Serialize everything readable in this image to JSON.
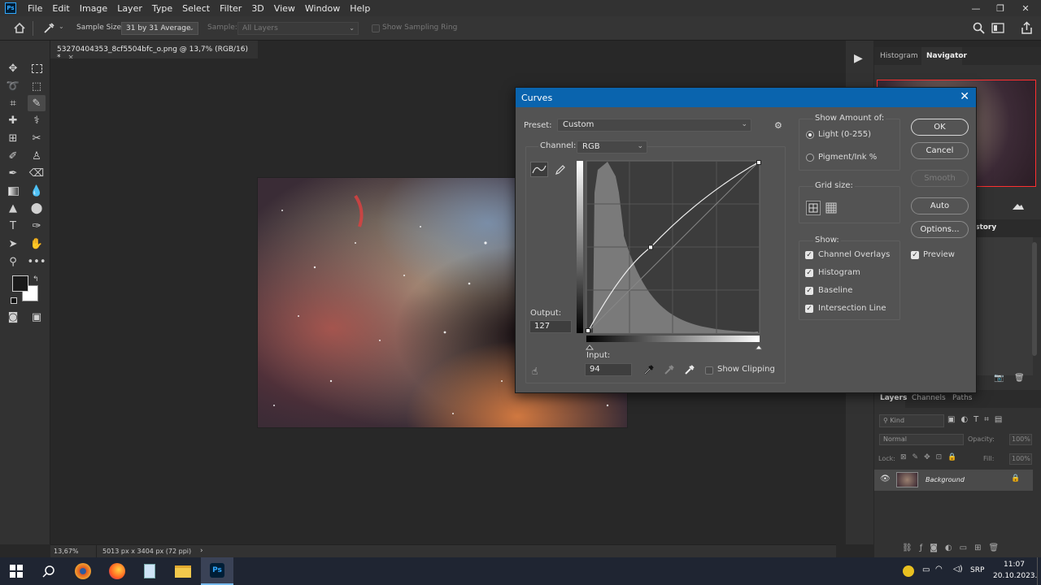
{
  "menubar": {
    "logo": "Ps",
    "items": [
      "File",
      "Edit",
      "Image",
      "Layer",
      "Type",
      "Select",
      "Filter",
      "3D",
      "View",
      "Window",
      "Help"
    ]
  },
  "options": {
    "sample_size_label": "Sample Size:",
    "sample_size_value": "31 by 31 Average",
    "sample_label": "Sample:",
    "sample_value": "All Layers",
    "show_ring_label": "Show Sampling Ring"
  },
  "document": {
    "tab_title": "53270404353_8cf5504bfc_o.png @ 13,7% (RGB/16) *",
    "close_glyph": "×"
  },
  "status": {
    "zoom": "13,67%",
    "doc_size": "5013 px x 3404 px (72 ppi)",
    "arrow": "›"
  },
  "panels": {
    "tab_histogram": "Histogram",
    "tab_navigator": "Navigator",
    "tab_history_partial": "istory",
    "tab_layers": "Layers",
    "tab_channels": "Channels",
    "tab_paths": "Paths",
    "kind_label": "Kind",
    "blend_mode": "Normal",
    "opacity_label": "Opacity:",
    "opacity_value": "100%",
    "lock_label": "Lock:",
    "fill_label": "Fill:",
    "fill_value": "100%",
    "layer_name": "Background"
  },
  "curves": {
    "title": "Curves",
    "close": "✕",
    "preset_label": "Preset:",
    "preset_value": "Custom",
    "channel_label": "Channel:",
    "channel_value": "RGB",
    "output_label": "Output:",
    "output_value": "127",
    "input_label": "Input:",
    "input_value": "94",
    "show_clipping_label": "Show Clipping",
    "show_amount_label": "Show Amount of:",
    "light_label": "Light  (0-255)",
    "pigment_label": "Pigment/Ink %",
    "grid_size_label": "Grid size:",
    "show_label": "Show:",
    "opt_channel_overlays": "Channel Overlays",
    "opt_histogram": "Histogram",
    "opt_baseline": "Baseline",
    "opt_intersection": "Intersection Line",
    "btn_ok": "OK",
    "btn_cancel": "Cancel",
    "btn_smooth": "Smooth",
    "btn_auto": "Auto",
    "btn_options": "Options...",
    "preview_label": "Preview",
    "curve_point": {
      "input": 94,
      "output": 127
    },
    "light_selected": true,
    "checks": {
      "overlays": true,
      "histogram": true,
      "baseline": true,
      "intersection": true,
      "preview": true,
      "clipping": false
    }
  },
  "taskbar": {
    "language": "SRP",
    "time": "11:07",
    "date": "20.10.2023."
  },
  "colors": {
    "accent": "#0a64ae",
    "ps_blue": "#31a8ff"
  }
}
